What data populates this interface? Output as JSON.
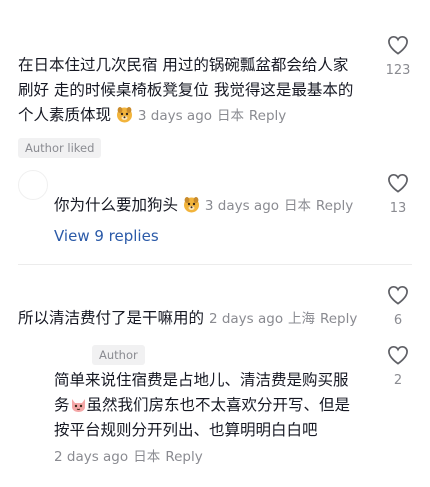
{
  "comments": [
    {
      "text_lines": [
        "在日本住过几次民宿 用过的锅碗瓢盆都会给人家",
        "刷好 走的时候桌椅板凳复位 我觉得这是最基本的",
        "个人素质体现"
      ],
      "emoji": "dog-face-emoji",
      "time": "3 days ago",
      "location": "日本",
      "reply_label": "Reply",
      "badge": "Author liked",
      "likes": "123"
    },
    {
      "text": "你为什么要加狗头",
      "emoji": "dog-face-emoji",
      "time": "3 days ago",
      "location": "日本",
      "reply_label": "Reply",
      "likes": "13",
      "view_replies": "View 9 replies"
    },
    {
      "text": "所以清洁费付了是干嘛用的",
      "time": "2 days ago",
      "location": "上海",
      "reply_label": "Reply",
      "likes": "6"
    },
    {
      "author_tag": "Author",
      "text_lines": [
        "简单来说住宿费是占地儿、清洁费是购买服",
        "虽然我们房东也不太喜欢分开写、但是",
        "按平台规则分开列出、也算明明白白吧"
      ],
      "line2_prefix": "务",
      "emoji": "cat-face-emoji",
      "time": "2 days ago",
      "location": "日本",
      "reply_label": "Reply",
      "likes": "2"
    }
  ],
  "colors": {
    "text": "#161823",
    "meta": "#8a8b91",
    "link": "#2b5aa8"
  }
}
